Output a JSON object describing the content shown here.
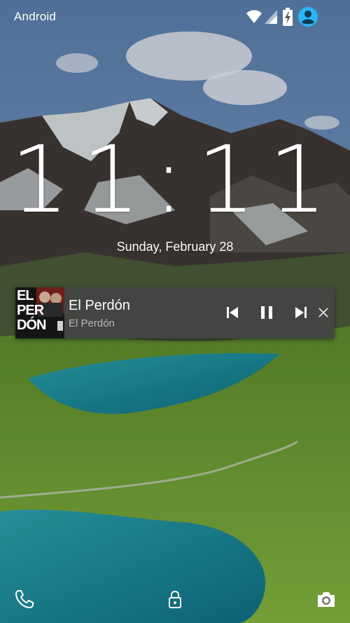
{
  "status_bar": {
    "carrier": "Android",
    "icons": [
      "wifi-icon",
      "cellular-signal-icon",
      "battery-charging-icon",
      "user-avatar-icon"
    ]
  },
  "lockscreen": {
    "time": "11:11",
    "date": "Sunday, February 28"
  },
  "media_notification": {
    "album_art_text": [
      "EL",
      "PER",
      "DÓN"
    ],
    "title": "El Perdón",
    "subtitle": "El Perdón",
    "controls": [
      "skip-previous-icon",
      "pause-icon",
      "skip-next-icon",
      "close-icon"
    ]
  },
  "bottom_actions": [
    "phone-icon",
    "lock-icon",
    "camera-icon"
  ],
  "colors": {
    "notification_bg": "#444444",
    "accent_avatar": "#29b6f6",
    "sky": "#6f93bf",
    "lake": "#1e8ea0",
    "grass": "#6fa83a"
  }
}
